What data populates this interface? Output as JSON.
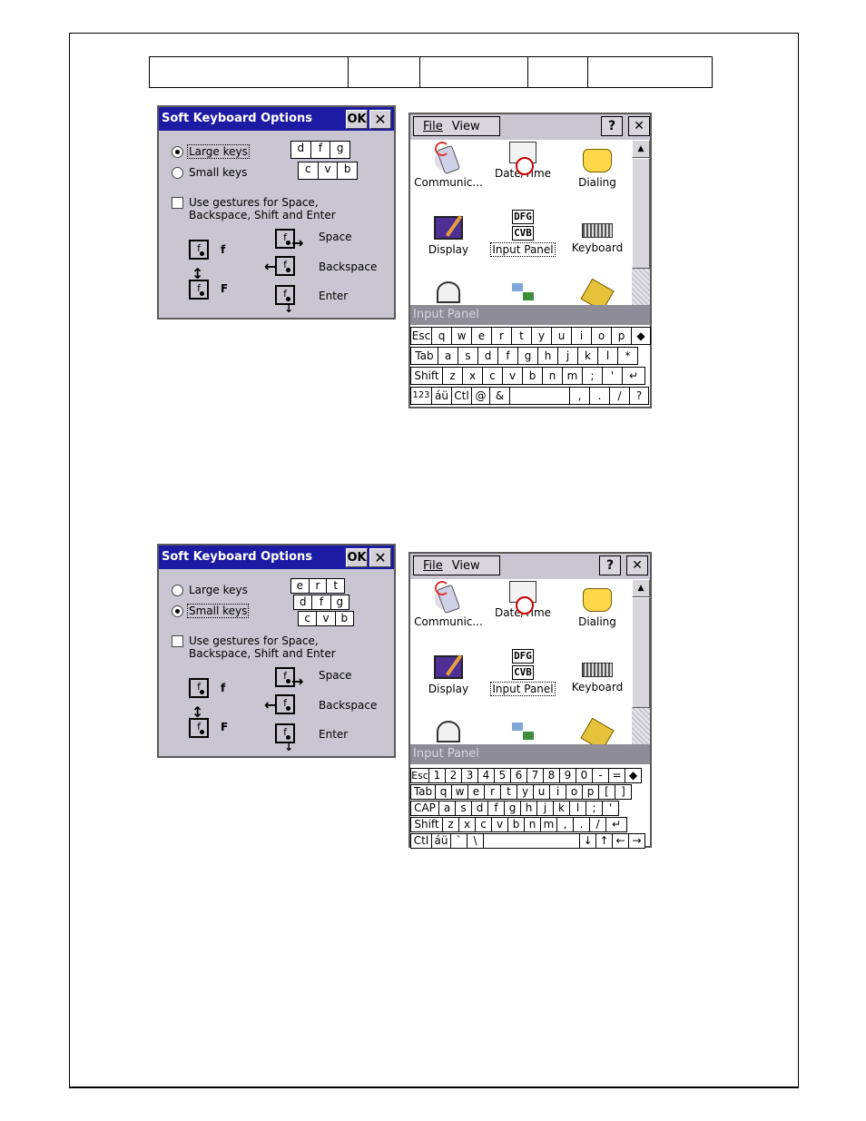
{
  "dialog": {
    "title": "Soft Keyboard Options",
    "ok_label": "OK",
    "close_label": "✕",
    "large_keys": "Large keys",
    "small_keys": "Small keys",
    "gestures_line1": "Use gestures for Space,",
    "gestures_line2": "Backspace, Shift and Enter",
    "preview_large_row": [
      "d",
      "f",
      "g"
    ],
    "preview_large_row2": [
      "c",
      "v",
      "b"
    ],
    "preview_small_row1": [
      "e",
      "r",
      "t"
    ],
    "preview_small_row2": [
      "d",
      "f",
      "g"
    ],
    "preview_small_row3": [
      "c",
      "v",
      "b"
    ],
    "gesture_letter": "f",
    "gesture_f_lower": "f",
    "gesture_f_upper": "F",
    "space": "Space",
    "backspace": "Backspace",
    "enter": "Enter"
  },
  "control_panel": {
    "menu_file": "File",
    "menu_view": "View",
    "help_label": "?",
    "close_label": "✕",
    "icons": [
      {
        "label": "Communic...",
        "icon": "communication-icon"
      },
      {
        "label": "Date/Time",
        "icon": "clock-icon"
      },
      {
        "label": "Dialing",
        "icon": "phone-icon"
      },
      {
        "label": "Display",
        "icon": "display-icon"
      },
      {
        "label": "Input Panel",
        "icon": "input-panel-icon"
      },
      {
        "label": "Keyboard",
        "icon": "keyboard-icon"
      }
    ],
    "dfg_row1": "DFG",
    "dfg_row2": "CVB",
    "input_panel_title": "Input Panel"
  },
  "large_keyboard": {
    "row1": [
      "Esc",
      "q",
      "w",
      "e",
      "r",
      "t",
      "y",
      "u",
      "i",
      "o",
      "p",
      "◆"
    ],
    "row2": [
      "Tab",
      "a",
      "s",
      "d",
      "f",
      "g",
      "h",
      "j",
      "k",
      "l",
      "*"
    ],
    "row3": [
      "Shift",
      "z",
      "x",
      "c",
      "v",
      "b",
      "n",
      "m",
      ";",
      "'",
      "↵"
    ],
    "row4": [
      "123",
      "áü",
      "Ctl",
      "@",
      "&",
      "",
      ",",
      ".",
      "/",
      "?"
    ]
  },
  "small_keyboard": {
    "row1": [
      "Esc",
      "1",
      "2",
      "3",
      "4",
      "5",
      "6",
      "7",
      "8",
      "9",
      "0",
      "-",
      "=",
      "◆"
    ],
    "row2": [
      "Tab",
      "q",
      "w",
      "e",
      "r",
      "t",
      "y",
      "u",
      "i",
      "o",
      "p",
      "[",
      "]"
    ],
    "row3": [
      "CAP",
      "a",
      "s",
      "d",
      "f",
      "g",
      "h",
      "j",
      "k",
      "l",
      ";",
      "'"
    ],
    "row4": [
      "Shift",
      "z",
      "x",
      "c",
      "v",
      "b",
      "n",
      "m",
      ",",
      ".",
      "/",
      "↵"
    ],
    "row5": [
      "Ctl",
      "áü",
      "`",
      "\\",
      "",
      "↓",
      "↑",
      "←",
      "→"
    ]
  }
}
